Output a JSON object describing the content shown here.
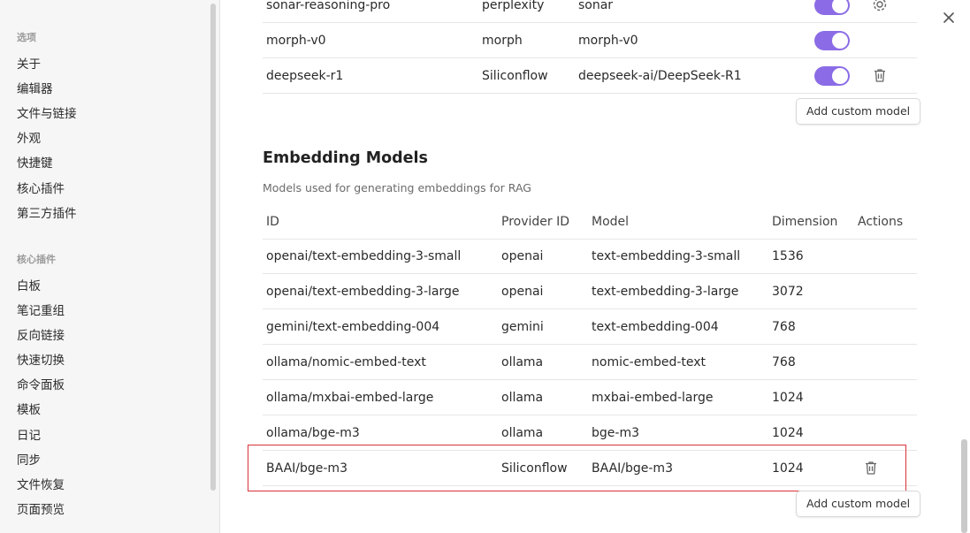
{
  "sidebar": {
    "section_options": "选项",
    "options_items": [
      "关于",
      "编辑器",
      "文件与链接",
      "外观",
      "快捷键",
      "核心插件",
      "第三方插件"
    ],
    "section_core_plugins": "核心插件",
    "core_plugin_items": [
      "白板",
      "笔记重组",
      "反向链接",
      "快速切换",
      "命令面板",
      "模板",
      "日记",
      "同步",
      "文件恢复",
      "页面预览"
    ]
  },
  "chat_models": {
    "rows": [
      {
        "id": "sonar-reasoning-pro",
        "provider": "perplexity",
        "model": "sonar",
        "enabled": true,
        "action": "gear-icon"
      },
      {
        "id": "morph-v0",
        "provider": "morph",
        "model": "morph-v0",
        "enabled": true,
        "action": ""
      },
      {
        "id": "deepseek-r1",
        "provider": "Siliconflow",
        "model": "deepseek-ai/DeepSeek-R1",
        "enabled": true,
        "action": "trash-icon"
      }
    ],
    "add_label": "Add custom model"
  },
  "embedding_models": {
    "title": "Embedding Models",
    "description": "Models used for generating embeddings for RAG",
    "headers": {
      "id": "ID",
      "provider": "Provider ID",
      "model": "Model",
      "dimension": "Dimension",
      "actions": "Actions"
    },
    "rows": [
      {
        "id": "openai/text-embedding-3-small",
        "provider": "openai",
        "model": "text-embedding-3-small",
        "dimension": "1536",
        "action": ""
      },
      {
        "id": "openai/text-embedding-3-large",
        "provider": "openai",
        "model": "text-embedding-3-large",
        "dimension": "3072",
        "action": ""
      },
      {
        "id": "gemini/text-embedding-004",
        "provider": "gemini",
        "model": "text-embedding-004",
        "dimension": "768",
        "action": ""
      },
      {
        "id": "ollama/nomic-embed-text",
        "provider": "ollama",
        "model": "nomic-embed-text",
        "dimension": "768",
        "action": ""
      },
      {
        "id": "ollama/mxbai-embed-large",
        "provider": "ollama",
        "model": "mxbai-embed-large",
        "dimension": "1024",
        "action": ""
      },
      {
        "id": "ollama/bge-m3",
        "provider": "ollama",
        "model": "bge-m3",
        "dimension": "1024",
        "action": ""
      },
      {
        "id": "BAAI/bge-m3",
        "provider": "Siliconflow",
        "model": "BAAI/bge-m3",
        "dimension": "1024",
        "action": "trash-icon"
      }
    ],
    "add_label": "Add custom model"
  },
  "colors": {
    "accent": "#8b6ce6",
    "highlight": "#d9323a"
  }
}
